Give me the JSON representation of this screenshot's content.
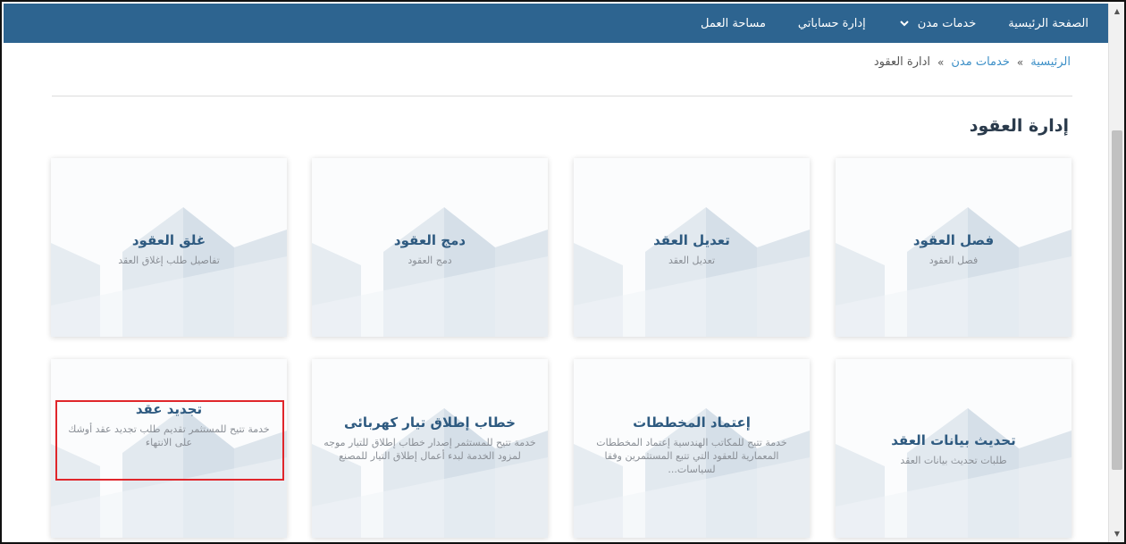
{
  "nav": {
    "home": "الصفحة الرئيسية",
    "services": "خدمات مدن",
    "accounts": "إدارة حساباتي",
    "workspace": "مساحة العمل"
  },
  "breadcrumb": {
    "home": "الرئيسية",
    "sep": "»",
    "services": "خدمات مدن",
    "current": "ادارة العقود"
  },
  "page": {
    "title": "إدارة العقود"
  },
  "cards": [
    {
      "title": "فصل العقود",
      "desc": "فصل العقود"
    },
    {
      "title": "تعديل العقد",
      "desc": "تعديل العقد"
    },
    {
      "title": "دمج العقود",
      "desc": "دمج العقود"
    },
    {
      "title": "غلق العقود",
      "desc": "تفاصيل طلب إغلاق العقد"
    },
    {
      "title": "تحديث بيانات العقد",
      "desc": "طلبات تحديث بيانات العقد"
    },
    {
      "title": "إعتماد المخططات",
      "desc": "خدمة تتيح للمكاتب الهندسية إعتماد المخططات المعمارية للعقود التي تتبع المستثمرين وفقا لسياسات..."
    },
    {
      "title": "خطاب إطلاق تيار كهربائى",
      "desc": "خدمة تتيح للمستثمر إصدار خطاب إطلاق للتيار موجه لمزود الخدمة لبدء أعمال إطلاق التيار للمصنع"
    },
    {
      "title": "تجديد عقد",
      "desc": "خدمة تتيح للمستثمر تقديم طلب تجديد عقد أوشك على الانتهاء"
    }
  ],
  "colors": {
    "navbar": "#2d6490",
    "link": "#3c8fc7",
    "cardTitle": "#2e5a80",
    "highlight": "#e0262b"
  },
  "icons": {
    "chevron": "chevron-down-icon",
    "scrollUp": "scroll-up-arrow-icon",
    "scrollDown": "scroll-down-arrow-icon"
  }
}
